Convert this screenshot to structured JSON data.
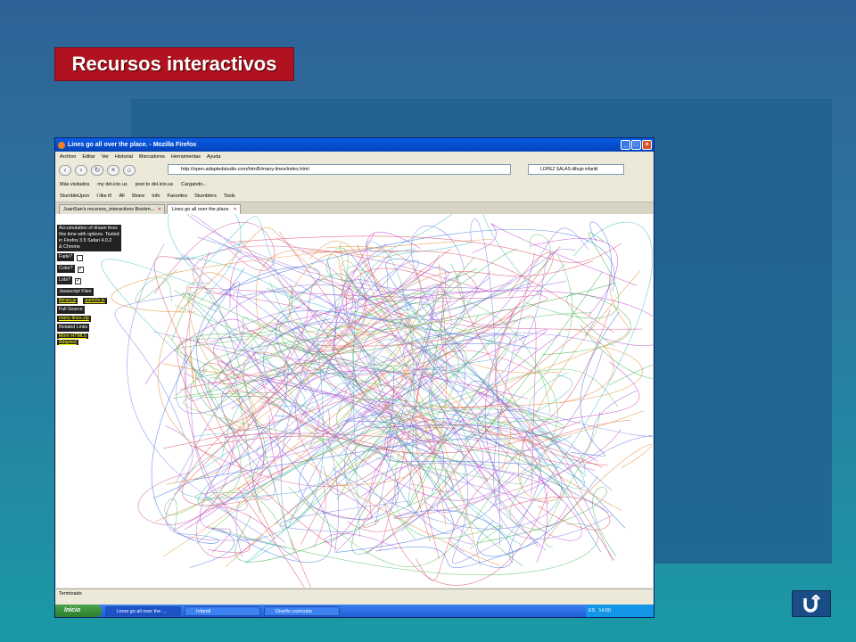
{
  "slide": {
    "title": "Recursos interactivos",
    "accent_color": "#b0121f",
    "return_icon": "return-arrow-icon"
  },
  "browser": {
    "window_title": "Lines go all over the place. - Mozilla Firefox",
    "menu": [
      "Archivo",
      "Editar",
      "Ver",
      "Historial",
      "Marcadores",
      "Herramientas",
      "Ayuda"
    ],
    "url": "http://open.adaptedstudio.com/html5/many-lines/index.html",
    "search_value": "LOPEZ SALAS dibujo infantil",
    "bookmarks": [
      "Más visitados",
      "my del.icio.us",
      "post to del.icio.us",
      "Cargando..."
    ],
    "stumble_toolbar": [
      "StumbleUpon",
      "I like it!",
      "All",
      "Share",
      "Info",
      "Favorites",
      "Stumblers",
      "Tools"
    ],
    "tabs": [
      {
        "label": "JuanSan's recursos_interactivos Bookm...",
        "active": false
      },
      {
        "label": "Lines go all over the place.",
        "active": true
      }
    ],
    "status": "Terminado"
  },
  "page_content": {
    "intro": [
      "Accumulation of drawn lines",
      "this time with options. Tested",
      "in Firefox 3.5 Safari 4.0.2",
      "& Chrome"
    ],
    "options": [
      {
        "label": "Fade?",
        "checked": false
      },
      {
        "label": "Color?",
        "checked": true
      },
      {
        "label": "Lots?",
        "checked": true
      }
    ],
    "js_files_heading": "Javascript Files",
    "js_files": [
      "library.js",
      "particle.js"
    ],
    "source_heading": "Full Source",
    "source_link": "many-lines.zip",
    "related_heading": "Related Links",
    "related_links": [
      "More HTML5",
      "Adapted"
    ]
  },
  "taskbar": {
    "start_label": "Inicio",
    "items": [
      {
        "label": "Lines go all over the ...",
        "active": true
      },
      {
        "label": "Infantil",
        "active": false
      },
      {
        "label": "Diseño curricular",
        "active": false
      }
    ],
    "language": "ES",
    "clock": "14:00"
  }
}
